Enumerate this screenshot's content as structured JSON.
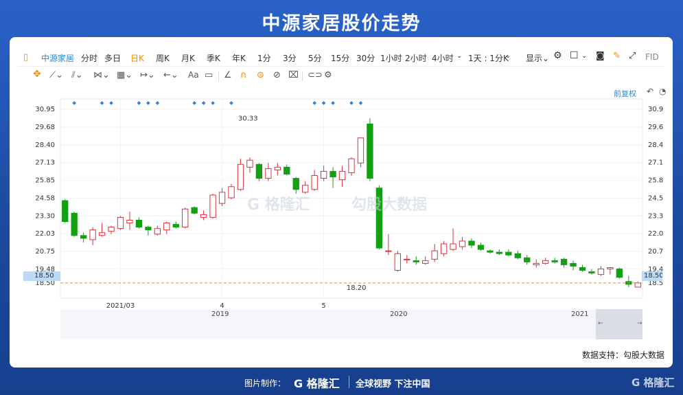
{
  "title": "中源家居股价走势",
  "toolbar": {
    "stock_name": "中源家居",
    "periods": [
      "分时",
      "多日",
      "日K",
      "周K",
      "月K",
      "季K",
      "年K",
      "1分",
      "3分",
      "5分",
      "15分",
      "30分",
      "1小时",
      "2小时",
      "4小时"
    ],
    "interval": "1天 : 1分K",
    "display": "显示⌄",
    "extra": "FID",
    "text_tool": "Aa",
    "adjust": "前复权"
  },
  "watermarks": {
    "left": "G 格隆汇",
    "right": "勾股大数据"
  },
  "credit": "数据支持：勾股大数据",
  "footer": {
    "made_by": "图片制作：",
    "brand": "G 格隆汇",
    "slogan": "全球视野 下注中国"
  },
  "colors": {
    "up": "#e0303a",
    "down": "#13a113",
    "accent": "#f08c00",
    "link": "#2f86d6"
  },
  "chart_data": {
    "type": "candlestick",
    "yticks": [
      "30.95",
      "29.68",
      "28.40",
      "27.13",
      "25.85",
      "24.58",
      "23.30",
      "22.03",
      "20.75",
      "19.48",
      "18.50"
    ],
    "ylim": [
      17.9,
      31.2
    ],
    "xtick_labels": [
      "2021/03",
      "4",
      "5"
    ],
    "xtick_index": [
      6,
      17,
      28
    ],
    "navigator_labels": [
      "2019",
      "2020",
      "2021"
    ],
    "last_price": 18.5,
    "last_price_label": "18.50",
    "high_label": "30.33",
    "low_label": "18.20",
    "high_index": 18,
    "low_index": 33,
    "events_index": [
      1,
      4,
      5,
      8,
      9,
      10,
      14,
      15,
      16,
      18,
      27,
      28,
      29,
      31,
      32
    ],
    "candles": [
      [
        24.4,
        22.9,
        24.5,
        22.8
      ],
      [
        23.5,
        21.9,
        23.6,
        21.8
      ],
      [
        21.9,
        21.7,
        22.1,
        21.4
      ],
      [
        21.6,
        22.3,
        22.5,
        21.2
      ],
      [
        21.9,
        22.1,
        22.8,
        21.8
      ],
      [
        22.2,
        22.5,
        22.6,
        22.0
      ],
      [
        22.4,
        23.2,
        23.3,
        22.3
      ],
      [
        22.8,
        23.0,
        23.6,
        22.3
      ],
      [
        23.0,
        22.5,
        23.2,
        22.4
      ],
      [
        22.5,
        22.3,
        22.6,
        21.9
      ],
      [
        22.0,
        22.4,
        22.6,
        21.9
      ],
      [
        22.3,
        22.8,
        22.9,
        22.0
      ],
      [
        22.7,
        22.5,
        22.9,
        22.4
      ],
      [
        22.5,
        23.8,
        23.9,
        22.4
      ],
      [
        23.9,
        23.5,
        24.0,
        23.4
      ],
      [
        23.2,
        23.4,
        23.7,
        23.0
      ],
      [
        23.2,
        24.8,
        24.9,
        23.1
      ],
      [
        24.2,
        25.0,
        25.3,
        24.0
      ],
      [
        24.6,
        25.4,
        25.6,
        24.5
      ],
      [
        25.2,
        27.0,
        27.4,
        25.1
      ],
      [
        26.8,
        27.3,
        27.5,
        26.4
      ],
      [
        27.0,
        26.0,
        27.1,
        25.8
      ],
      [
        26.0,
        26.7,
        27.1,
        25.8
      ],
      [
        26.6,
        26.8,
        27.1,
        26.2
      ],
      [
        26.8,
        26.3,
        27.0,
        26.2
      ],
      [
        26.0,
        25.2,
        26.1,
        24.9
      ],
      [
        25.0,
        25.5,
        25.8,
        24.9
      ],
      [
        25.2,
        26.2,
        26.6,
        25.1
      ],
      [
        26.0,
        26.5,
        26.9,
        25.8
      ],
      [
        26.5,
        26.1,
        26.8,
        25.3
      ],
      [
        25.9,
        26.5,
        26.9,
        25.4
      ],
      [
        26.4,
        27.4,
        27.5,
        26.2
      ],
      [
        27.1,
        28.9,
        28.9,
        26.8
      ],
      [
        29.9,
        26.0,
        30.3,
        25.8
      ],
      [
        25.3,
        21.0,
        25.5,
        20.9
      ],
      [
        20.8,
        20.8,
        22.0,
        20.5
      ],
      [
        19.4,
        20.6,
        20.8,
        19.3
      ],
      [
        20.2,
        20.2,
        20.5,
        19.9
      ],
      [
        20.1,
        20.0,
        20.4,
        19.8
      ],
      [
        19.9,
        20.1,
        20.4,
        19.8
      ],
      [
        20.2,
        20.8,
        21.3,
        20.0
      ],
      [
        20.6,
        21.3,
        21.5,
        20.4
      ],
      [
        20.9,
        21.3,
        22.4,
        20.8
      ],
      [
        21.1,
        21.5,
        21.8,
        20.9
      ],
      [
        21.5,
        21.2,
        21.7,
        21.0
      ],
      [
        21.2,
        20.9,
        21.4,
        20.8
      ],
      [
        20.8,
        20.7,
        20.9,
        20.6
      ],
      [
        20.7,
        20.6,
        20.9,
        20.5
      ],
      [
        20.7,
        20.5,
        20.9,
        20.4
      ],
      [
        20.6,
        20.3,
        20.8,
        20.2
      ],
      [
        20.3,
        20.0,
        20.5,
        19.8
      ],
      [
        19.8,
        19.9,
        20.2,
        19.6
      ],
      [
        19.9,
        20.1,
        20.3,
        19.8
      ],
      [
        20.1,
        20.0,
        20.3,
        19.9
      ],
      [
        20.2,
        19.8,
        20.3,
        19.6
      ],
      [
        19.9,
        19.7,
        20.1,
        19.4
      ],
      [
        19.6,
        19.4,
        19.8,
        19.3
      ],
      [
        19.3,
        19.2,
        19.5,
        19.1
      ],
      [
        19.1,
        19.5,
        19.7,
        19.0
      ],
      [
        19.5,
        19.6,
        19.6,
        19.1
      ],
      [
        19.5,
        18.9,
        19.6,
        18.8
      ],
      [
        18.6,
        18.4,
        19.0,
        18.2
      ],
      [
        18.2,
        18.5,
        18.6,
        18.2
      ]
    ]
  }
}
